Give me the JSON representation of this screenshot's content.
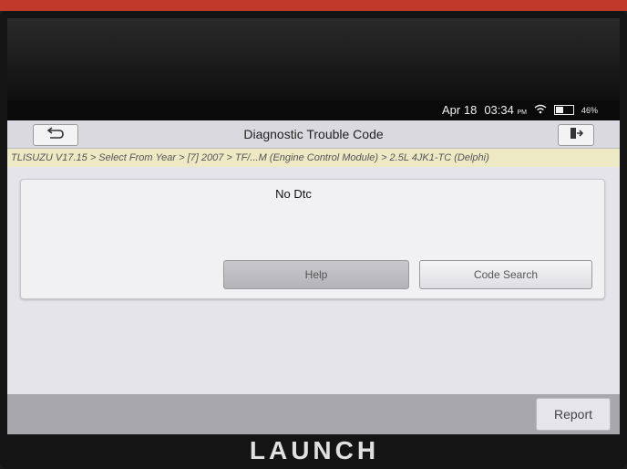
{
  "status_bar": {
    "date": "Apr 18",
    "time": "03:34",
    "ampm": "PM",
    "battery": "46%",
    "battery_level": 0.46
  },
  "header": {
    "title": "Diagnostic Trouble Code",
    "back_icon": "back-arrow-icon",
    "exit_icon": "exit-icon"
  },
  "breadcrumb": "TLISUZU V17.15 > Select From Year > [7] 2007 > TF/...M (Engine Control Module) > 2.5L 4JK1-TC (Delphi)",
  "panel": {
    "message": "No Dtc",
    "help_label": "Help",
    "code_search_label": "Code Search"
  },
  "footer": {
    "report_label": "Report"
  },
  "device": {
    "brand": "LAUNCH"
  }
}
